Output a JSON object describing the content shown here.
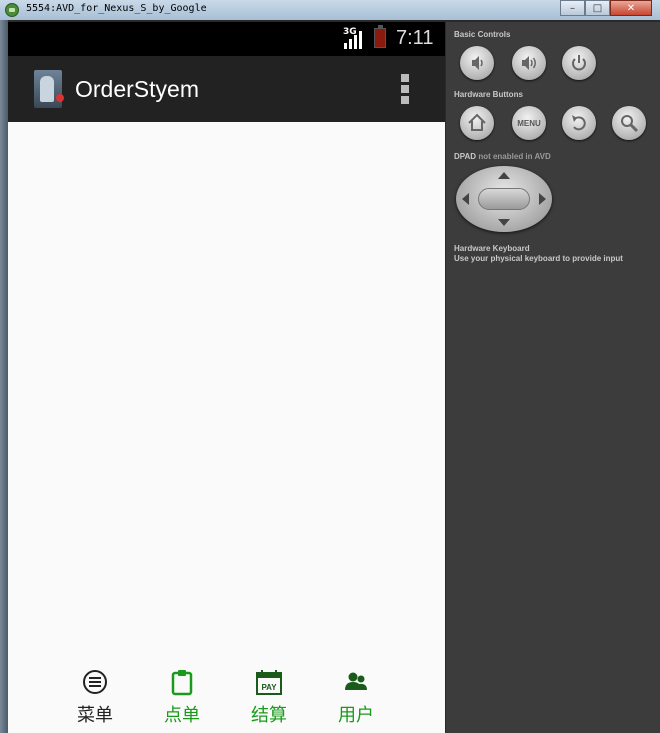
{
  "window": {
    "title": "5554:AVD_for_Nexus_S_by_Google",
    "controls": {
      "minimize": "–",
      "maximize": "□",
      "close": "✕"
    }
  },
  "status_bar": {
    "network": "3G",
    "time": "7:11"
  },
  "action_bar": {
    "title": "OrderStyem",
    "overflow_icon": "overflow-menu-icon"
  },
  "bottom_tabs": [
    {
      "label": "菜单",
      "icon": "list-icon",
      "color": "#222222"
    },
    {
      "label": "点单",
      "icon": "clipboard-icon",
      "color": "#1a9a1a"
    },
    {
      "label": "结算",
      "icon": "pay-calendar-icon",
      "color": "#1a9a1a"
    },
    {
      "label": "用户",
      "icon": "users-icon",
      "color": "#1a9a1a"
    }
  ],
  "controls_panel": {
    "basic_controls_heading": "Basic Controls",
    "hardware_buttons_heading": "Hardware Buttons",
    "menu_button_label": "MENU",
    "dpad_heading_main": "DPAD",
    "dpad_heading_note": "not enabled in AVD",
    "keyboard_heading": "Hardware Keyboard",
    "keyboard_note": "Use your physical keyboard to provide input"
  },
  "colors": {
    "accent_green": "#1a9a1a",
    "action_bar": "#222222",
    "panel_bg": "#3c3c3c"
  }
}
